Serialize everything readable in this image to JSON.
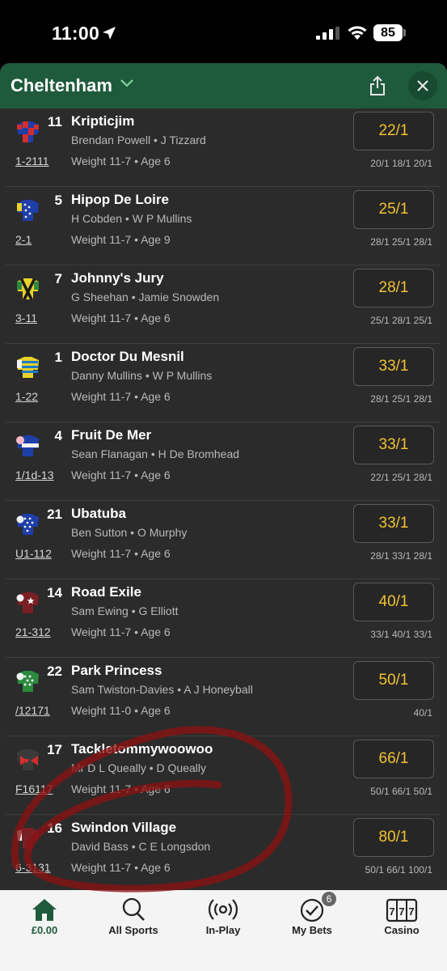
{
  "status": {
    "time": "11:00",
    "battery": "85"
  },
  "header": {
    "title": "Cheltenham"
  },
  "runners": [
    {
      "num": "11",
      "name": "Kripticjim",
      "people": "Brendan Powell • J Tizzard",
      "form": "1-2111",
      "info": "Weight 11-7 • Age 6",
      "odds": "22/1",
      "prev": "20/1  18/1  20/1"
    },
    {
      "num": "5",
      "name": "Hipop De Loire",
      "people": "H Cobden • W P Mullins",
      "form": "2-1",
      "info": "Weight 11-7 • Age 9",
      "odds": "25/1",
      "prev": "28/1  25/1  28/1"
    },
    {
      "num": "7",
      "name": "Johnny's Jury",
      "people": "G Sheehan • Jamie Snowden",
      "form": "3-11",
      "info": "Weight 11-7 • Age 6",
      "odds": "28/1",
      "prev": "25/1  28/1  25/1"
    },
    {
      "num": "1",
      "name": "Doctor Du Mesnil",
      "people": "Danny Mullins • W P Mullins",
      "form": "1-22",
      "info": "Weight 11-7 • Age 6",
      "odds": "33/1",
      "prev": "28/1  25/1  28/1"
    },
    {
      "num": "4",
      "name": "Fruit De Mer",
      "people": "Sean Flanagan • H De Bromhead",
      "form": "1/1d-13",
      "info": "Weight 11-7 • Age 6",
      "odds": "33/1",
      "prev": "22/1  25/1  28/1"
    },
    {
      "num": "21",
      "name": "Ubatuba",
      "people": "Ben Sutton • O Murphy",
      "form": "U1-112",
      "info": "Weight 11-7 • Age 6",
      "odds": "33/1",
      "prev": "28/1  33/1  28/1"
    },
    {
      "num": "14",
      "name": "Road Exile",
      "people": "Sam Ewing • G Elliott",
      "form": "21-312",
      "info": "Weight 11-7 • Age 6",
      "odds": "40/1",
      "prev": "33/1  40/1  33/1"
    },
    {
      "num": "22",
      "name": "Park Princess",
      "people": "Sam Twiston-Davies • A J Honeyball",
      "form": "/12171",
      "info": "Weight 11-0 • Age 6",
      "odds": "50/1",
      "prev": "40/1"
    },
    {
      "num": "17",
      "name": "Tackletommywoowoo",
      "people": "Mr D L Queally • D Queally",
      "form": "F16117",
      "info": "Weight 11-7 • Age 6",
      "odds": "66/1",
      "prev": "50/1  66/1  50/1"
    },
    {
      "num": "16",
      "name": "Swindon Village",
      "people": "David Bass • C E Longsdon",
      "form": "6-3131",
      "info": "Weight 11-7 • Age 6",
      "odds": "80/1",
      "prev": "50/1  66/1  100/1"
    }
  ],
  "tabs": [
    {
      "label": "£0.00",
      "icon": "home-icon"
    },
    {
      "label": "All Sports",
      "icon": "search-icon"
    },
    {
      "label": "In-Play",
      "icon": "in-play-icon"
    },
    {
      "label": "My Bets",
      "icon": "my-bets-icon",
      "badge": "6"
    },
    {
      "label": "Casino",
      "icon": "casino-icon"
    }
  ]
}
